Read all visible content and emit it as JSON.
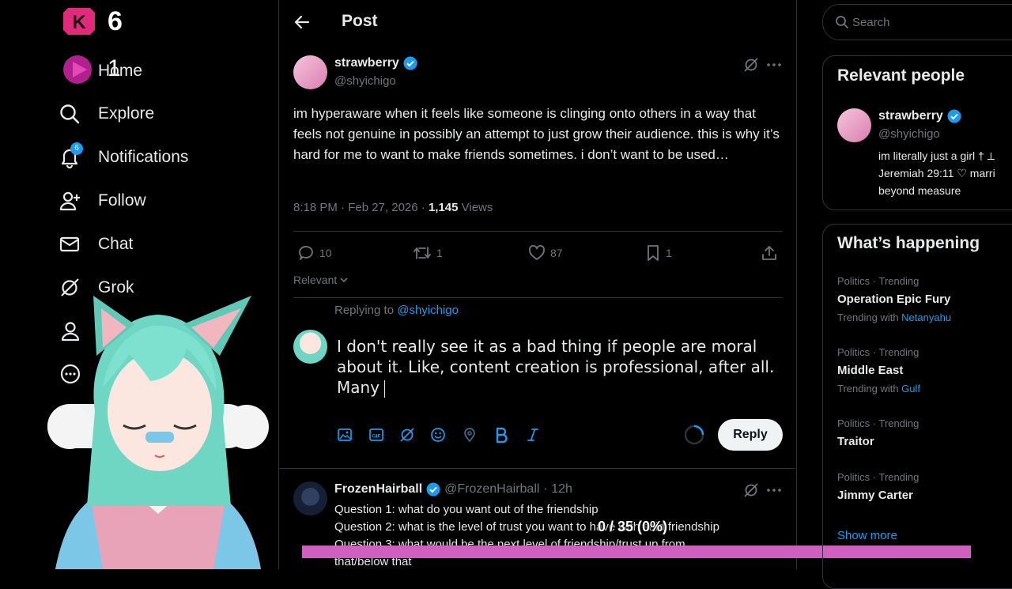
{
  "overlay": {
    "counter_k": "6",
    "counter_play": "1",
    "progress_text": "0 / 35 (0%)",
    "progress": 0
  },
  "nav": {
    "items": [
      {
        "label": "Home"
      },
      {
        "label": "Explore"
      },
      {
        "label": "Notifications",
        "badge": "6"
      },
      {
        "label": "Follow"
      },
      {
        "label": "Chat"
      },
      {
        "label": "Grok"
      }
    ]
  },
  "header": {
    "title": "Post"
  },
  "post": {
    "display_name": "strawberry",
    "handle": "@shyichigo",
    "text": "im hyperaware when it feels like someone is clinging onto others in a way that feels not genuine in possibly an attempt to just grow their audience. this is why it’s hard for me to want to make friends sometimes. i don’t want to be used…",
    "time": "8:18 PM · Feb 27, 2026 · ",
    "views_count": "1,145",
    "views_label": " Views",
    "replies": "10",
    "reposts": "1",
    "likes": "87",
    "bookmarks": "1"
  },
  "sort": {
    "label": "Relevant"
  },
  "reply_box": {
    "replying_prefix": "Replying to ",
    "replying_handle": "@shyichigo",
    "draft": "I don't really see it as a bad thing if people are moral about it. Like, content creation is professional, after all. Many ",
    "reply_button": "Reply"
  },
  "reply": {
    "display_name": "FrozenHairball",
    "handle": "@FrozenHairball",
    "time": "· 12h",
    "lines": [
      "Question 1: what do you want out of the friendship",
      "Question 2: what is the level of trust you want to have with said friendship",
      "Question 3: what would be the next level of friendship/trust up from",
      "that/below that"
    ]
  },
  "search": {
    "placeholder": "Search"
  },
  "relevant": {
    "title": "Relevant people",
    "name": "strawberry",
    "handle": "@shyichigo",
    "bio": [
      "im literally just a girl † ⟂",
      "Jeremiah 29:11 ♡ marri",
      "beyond measure"
    ]
  },
  "happening": {
    "title": "What’s happening",
    "trends": [
      {
        "category": "Politics · Trending",
        "name": "Operation Epic Fury",
        "with_label": "Trending with ",
        "with": "Netanyahu"
      },
      {
        "category": "Politics · Trending",
        "name": "Middle East",
        "with_label": "Trending with ",
        "with": "Gulf"
      },
      {
        "category": "Politics · Trending",
        "name": "Traitor"
      },
      {
        "category": "Politics · Trending",
        "name": "Jimmy Carter"
      }
    ],
    "show_more": "Show more"
  },
  "colors": {
    "accent": "#1d9bf0",
    "overlay_bar": "#d060c0",
    "avatar_pink": "#e8a0c8"
  }
}
